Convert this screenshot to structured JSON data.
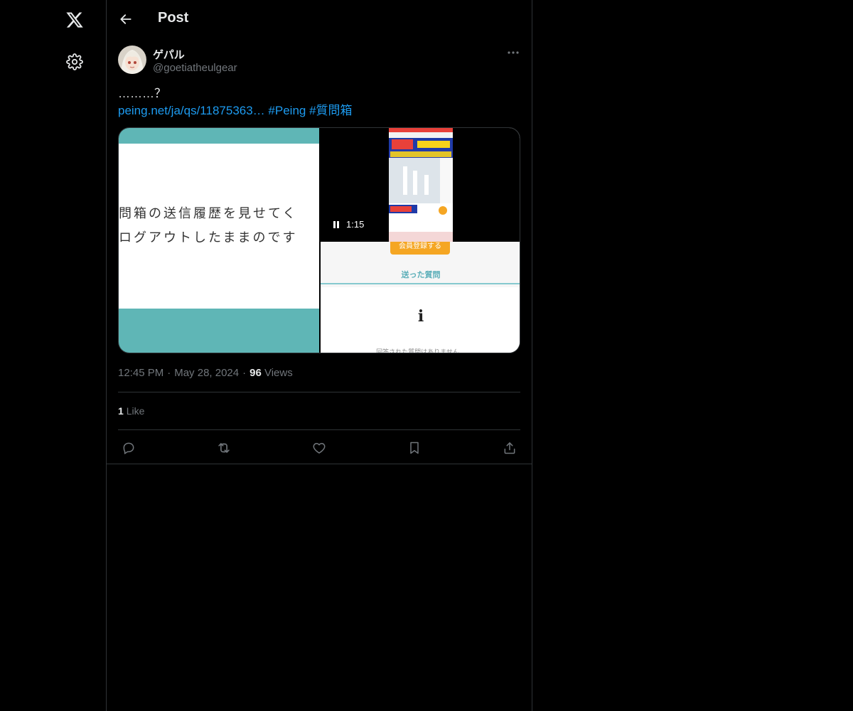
{
  "nav": {
    "logo_icon": "x-logo-icon",
    "settings_icon": "gear-icon"
  },
  "header": {
    "back_icon": "arrow-left-icon",
    "title": "Post"
  },
  "post": {
    "author": {
      "display_name": "ゲパル",
      "handle": "@goetiatheulgear"
    },
    "text": "………？",
    "link": "peing.net/ja/qs/11875363…",
    "hashtags": [
      "#Peing",
      "#質問箱"
    ],
    "media": {
      "left_image": {
        "lines": [
          "問箱の送信履歴を見せてく",
          "ログアウトしたままのです"
        ]
      },
      "right_video": {
        "time": "1:15",
        "button_text": "会員登録する",
        "section_label": "送った質問",
        "info_symbol": "i",
        "empty_text": "回答された質問はありません。"
      }
    },
    "time": "12:45 PM",
    "date": "May 28, 2024",
    "views_count": "96",
    "views_label": "Views",
    "likes_count": "1",
    "likes_label": "Like"
  },
  "actions": [
    {
      "name": "reply",
      "icon": "reply-icon"
    },
    {
      "name": "repost",
      "icon": "repost-icon"
    },
    {
      "name": "like",
      "icon": "heart-icon"
    },
    {
      "name": "bookmark",
      "icon": "bookmark-icon"
    },
    {
      "name": "share",
      "icon": "share-icon"
    }
  ],
  "colors": {
    "background": "#000000",
    "text": "#e7e9ea",
    "muted": "#71767b",
    "link": "#1d9bf0",
    "border": "#2f3336",
    "teal": "#5fb6b6"
  }
}
